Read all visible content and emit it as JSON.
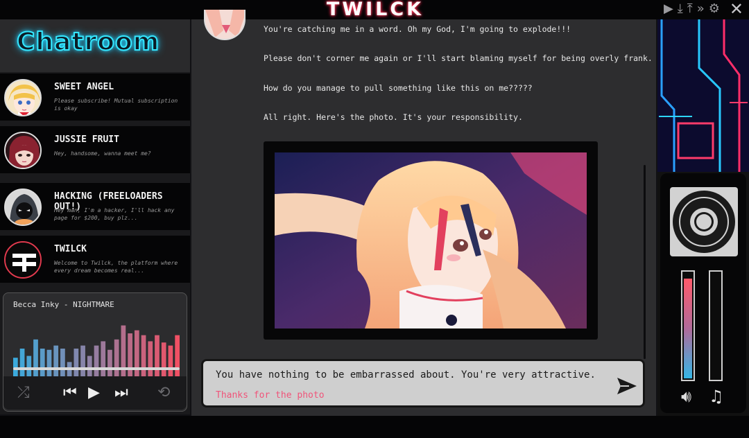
{
  "app": {
    "logo_text": "TWILCK",
    "window_icons": [
      "play-icon",
      "download-icon",
      "upload-icon",
      "fast-forward-icon",
      "gear-icon",
      "close-icon"
    ]
  },
  "sidebar": {
    "title": "Chatroom",
    "contacts": [
      {
        "name": "SWEET ANGEL",
        "preview": "Please subscribe! Mutual subscription is okay"
      },
      {
        "name": "JUSSIE FRUIT",
        "preview": "Hey, handsome, wanna meet me?"
      },
      {
        "name": "HACKING (FREELOADERS OUT!)",
        "preview": "Hey man, I'm a hacker, I'll hack any page for $200, buy plz..."
      },
      {
        "name": "TWILCK",
        "preview": "Welcome to Twilck, the platform where every dream becomes real..."
      }
    ]
  },
  "player": {
    "track": "Becca Inky - NIGHTMARE",
    "progress": 1.0,
    "eq_levels": [
      0.35,
      0.5,
      0.38,
      0.65,
      0.5,
      0.48,
      0.55,
      0.5,
      0.28,
      0.5,
      0.55,
      0.38,
      0.55,
      0.62,
      0.48,
      0.65,
      0.88,
      0.75,
      0.8,
      0.72,
      0.62,
      0.72,
      0.6,
      0.55,
      0.72
    ],
    "controls": [
      "shuffle-icon",
      "previous-icon",
      "play-icon",
      "next-icon",
      "repeat-icon"
    ]
  },
  "chat": {
    "messages": [
      "You're catching me in a word. Oh my God, I'm going to explode!!!",
      "Please don't corner me again or I'll start blaming myself for being overly frank.",
      "How do you manage to pull something like this on me?????",
      "All right. Here's the photo. It's your responsibility."
    ],
    "composer": {
      "typed": "You have nothing to be embarrassed about. You're very attractive.",
      "hint": "Thanks for the photo"
    }
  },
  "right_panel": {
    "volume_level": 0.95,
    "music_level": 0.0,
    "icons": [
      "speaker-icon",
      "music-note-icon"
    ]
  },
  "colors": {
    "accent_cyan": "#35e7ff",
    "accent_pink": "#f0547a",
    "logo_glow": "#ff3b5c"
  }
}
